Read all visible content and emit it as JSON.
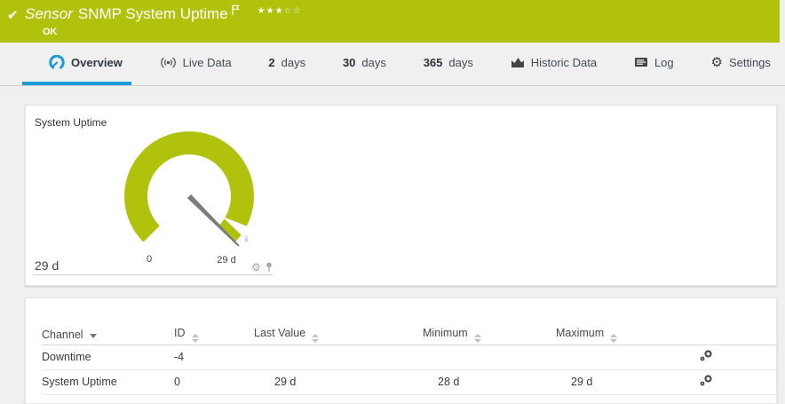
{
  "banner": {
    "check_icon": "✔",
    "title_prefix": "Sensor",
    "title": "SNMP System Uptime",
    "status": "OK",
    "stars_filled": "★★★",
    "stars_empty": "☆☆"
  },
  "tabs": {
    "overview": "Overview",
    "live_data": "Live Data",
    "d2_num": "2",
    "d2_label": "days",
    "d30_num": "30",
    "d30_label": "days",
    "d365_num": "365",
    "d365_label": "days",
    "historic": "Historic Data",
    "log": "Log",
    "settings": "Settings"
  },
  "gauge_panel": {
    "title": "System Uptime",
    "value": "29 d",
    "scale_min": "0",
    "scale_max": "29 d",
    "avg_marker": "x̄"
  },
  "chart_data": {
    "type": "gauge",
    "title": "System Uptime",
    "scale_min_label": "0",
    "scale_max_label": "29 d",
    "value_label": "29 d",
    "needle_at": "max",
    "arc_degrees": 270
  },
  "channel_table": {
    "headers": {
      "channel": "Channel",
      "id": "ID",
      "last_value": "Last Value",
      "minimum": "Minimum",
      "maximum": "Maximum"
    },
    "rows": [
      {
        "channel": "Downtime",
        "id": "-4",
        "last_value": "",
        "minimum": "",
        "maximum": ""
      },
      {
        "channel": "System Uptime",
        "id": "0",
        "last_value": "29 d",
        "minimum": "28 d",
        "maximum": "29 d"
      }
    ]
  },
  "colors": {
    "status_green": "#b1c20d",
    "accent_blue": "#1d9bd7",
    "needle_gray": "#7c7c7c"
  }
}
